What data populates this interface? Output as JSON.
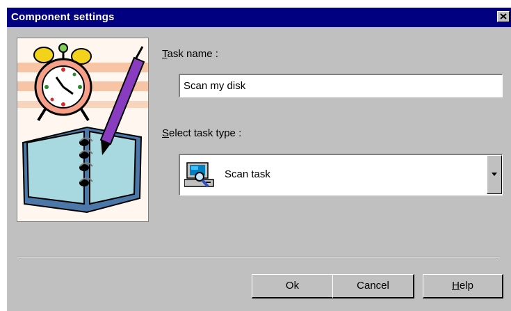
{
  "window": {
    "title": "Component settings"
  },
  "form": {
    "task_name_label_first": "T",
    "task_name_label_rest": "ask name :",
    "task_name_value": "Scan my disk",
    "task_type_label_first": "S",
    "task_type_label_rest": "elect task type :",
    "task_type_selected": "Scan task",
    "task_type_icon": "computer-scan-icon"
  },
  "buttons": {
    "ok": "Ok",
    "cancel": "Cancel",
    "help_first": "H",
    "help_rest": "elp"
  },
  "colors": {
    "titlebar": "#000080",
    "dialog_bg": "#c0c0c0",
    "field_bg": "#ffffff"
  }
}
